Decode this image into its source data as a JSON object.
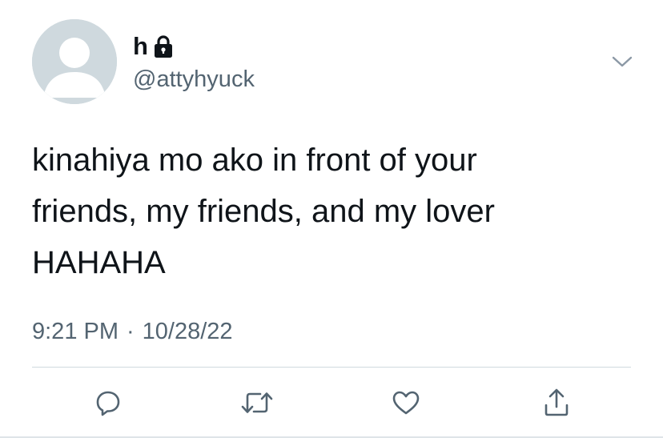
{
  "tweet": {
    "author": {
      "display_name": "h",
      "handle": "@attyhyuck",
      "protected_icon": "lock-icon",
      "avatar": "default-avatar"
    },
    "text_lines": [
      "kinahiya mo ako in front of your",
      "friends, my friends, and my lover",
      "HAHAHA"
    ],
    "time": "9:21 PM",
    "separator": "·",
    "date": "10/28/22",
    "menu_icon": "chevron-down-icon"
  },
  "actions": [
    {
      "name": "reply",
      "icon": "reply-icon"
    },
    {
      "name": "retweet",
      "icon": "retweet-icon"
    },
    {
      "name": "like",
      "icon": "heart-icon"
    },
    {
      "name": "share",
      "icon": "share-icon"
    }
  ],
  "colors": {
    "text": "#0f1419",
    "secondary": "#536471",
    "avatar_bg": "#cfd9de",
    "divider": "#cfd9de"
  }
}
